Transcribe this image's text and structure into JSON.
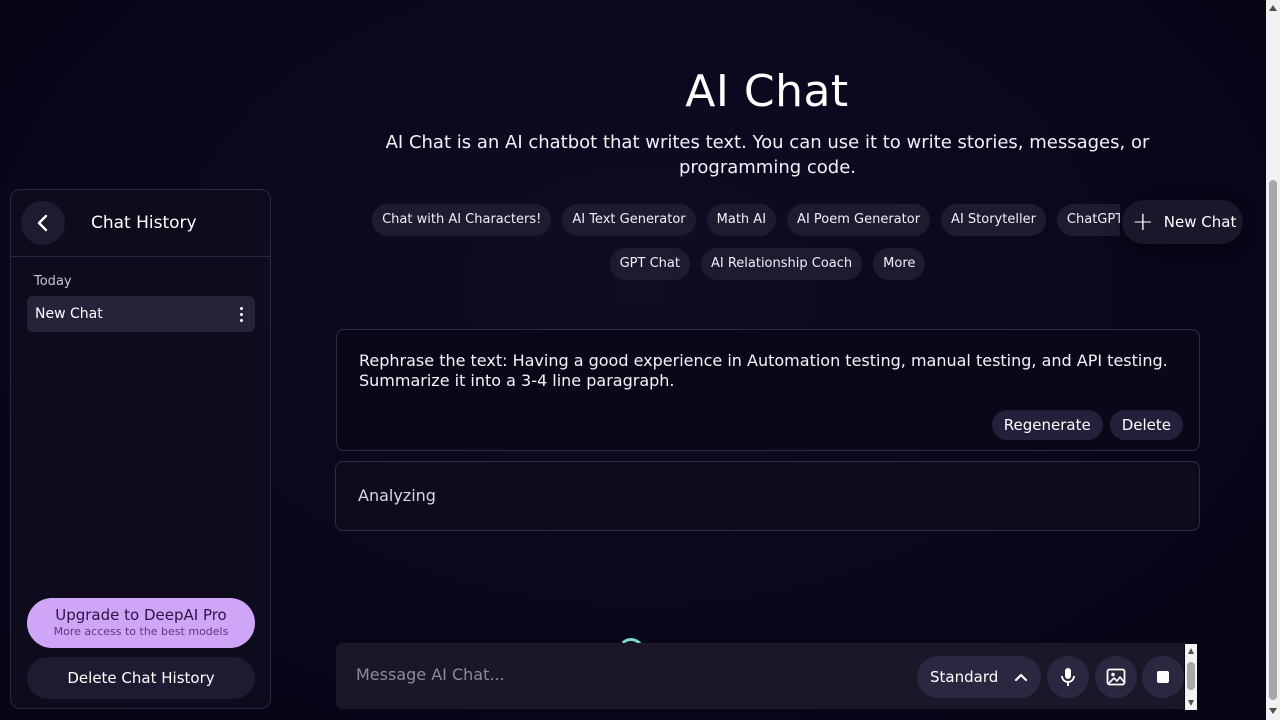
{
  "hero": {
    "title": "AI Chat",
    "description": "AI Chat is an AI chatbot that writes text. You can use it to write stories, messages, or programming code."
  },
  "chips": [
    "Chat with AI Characters!",
    "AI Text Generator",
    "Math AI",
    "AI Poem Generator",
    "AI Storyteller",
    "ChatGPT Alte",
    "GPT Chat",
    "AI Relationship Coach",
    "More"
  ],
  "new_chat_button": "New Chat",
  "sidebar": {
    "title": "Chat History",
    "section_label": "Today",
    "chats": [
      "New Chat"
    ],
    "upgrade_title": "Upgrade to DeepAI Pro",
    "upgrade_subtitle": "More access to the best models",
    "delete_history": "Delete Chat History"
  },
  "conversation": {
    "user_message": "Rephrase the text: Having a good experience in Automation testing, manual testing, and API testing. Summarize it into a 3-4 line paragraph.",
    "regenerate_label": "Regenerate",
    "delete_label": "Delete",
    "response_status": "Analyzing"
  },
  "composer": {
    "placeholder": "Message AI Chat...",
    "mode": "Standard"
  },
  "icons": {
    "back": "chevron-left-icon",
    "plus": "plus-icon",
    "kebab": "more-vertical-icon",
    "mode_toggle": "chevron-up-icon",
    "mic": "microphone-icon",
    "image": "image-icon",
    "stop": "stop-icon"
  },
  "colors": {
    "background": "#08071a",
    "upgrade_accent": "#cfa6f7",
    "spinner": "#7fd8c8"
  }
}
